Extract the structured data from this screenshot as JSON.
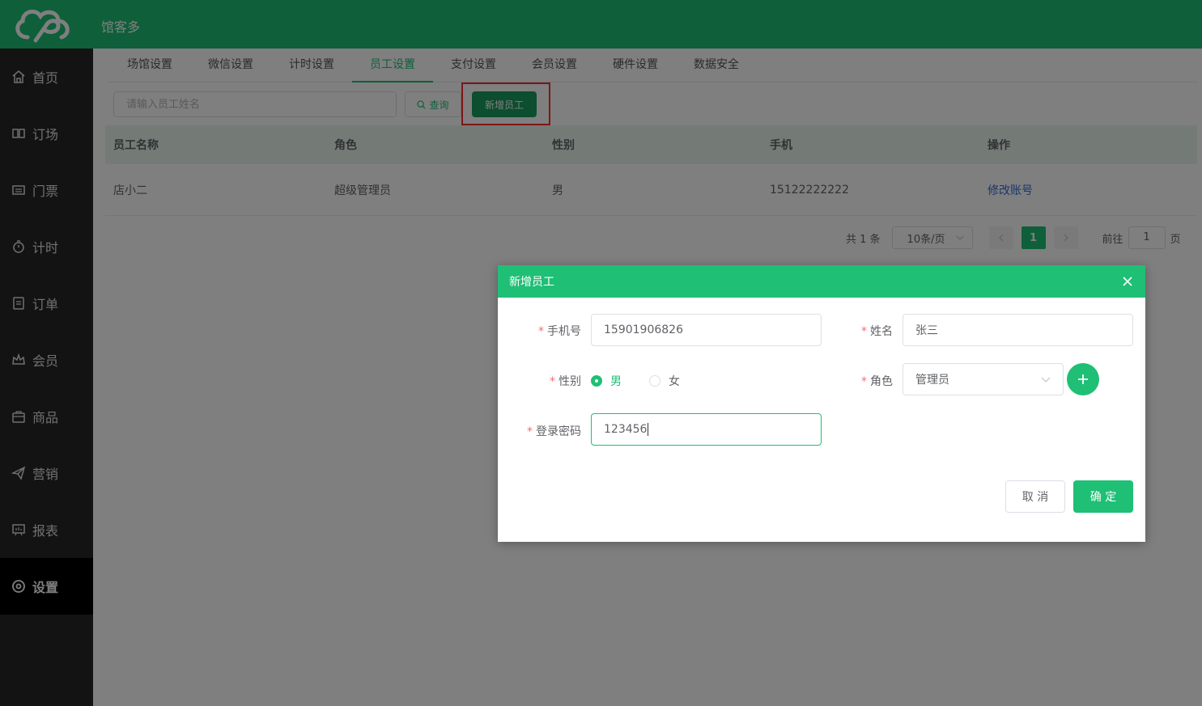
{
  "app": {
    "name": "馆客多"
  },
  "sidebar": {
    "items": [
      {
        "label": "首页",
        "icon": "home-icon"
      },
      {
        "label": "订场",
        "icon": "court-icon"
      },
      {
        "label": "门票",
        "icon": "ticket-icon"
      },
      {
        "label": "计时",
        "icon": "timer-icon"
      },
      {
        "label": "订单",
        "icon": "order-icon"
      },
      {
        "label": "会员",
        "icon": "member-icon"
      },
      {
        "label": "商品",
        "icon": "goods-icon"
      },
      {
        "label": "营销",
        "icon": "marketing-icon"
      },
      {
        "label": "报表",
        "icon": "report-icon"
      },
      {
        "label": "设置",
        "icon": "settings-icon",
        "active": true
      }
    ]
  },
  "tabs": [
    "场馆设置",
    "微信设置",
    "计时设置",
    "员工设置",
    "支付设置",
    "会员设置",
    "硬件设置",
    "数据安全"
  ],
  "toolbar": {
    "search_placeholder": "请输入员工姓名",
    "query_label": "查询",
    "add_label": "新增员工"
  },
  "table": {
    "headers": [
      "员工名称",
      "角色",
      "性别",
      "手机",
      "操作"
    ],
    "rows": [
      {
        "name": "店小二",
        "role": "超级管理员",
        "gender": "男",
        "phone": "15122222222",
        "action": "修改账号"
      }
    ]
  },
  "pagination": {
    "total": "共 1 条",
    "page_size": "10条/页",
    "current": "1",
    "goto_label": "前往",
    "goto_value": "1",
    "page_suffix": "页"
  },
  "dialog": {
    "title": "新增员工",
    "phone_label": "手机号",
    "phone_value": "15901906826",
    "name_label": "姓名",
    "name_value": "张三",
    "gender_label": "性别",
    "gender_options": [
      "男",
      "女"
    ],
    "role_label": "角色",
    "role_value": "管理员",
    "password_label": "登录密码",
    "password_value": "123456",
    "cancel_label": "取 消",
    "ok_label": "确 定"
  },
  "colors": {
    "brand": "#1fbf75",
    "sidebar": "#272727",
    "highlight": "#ff2b2b",
    "link": "#2f6cd9"
  }
}
